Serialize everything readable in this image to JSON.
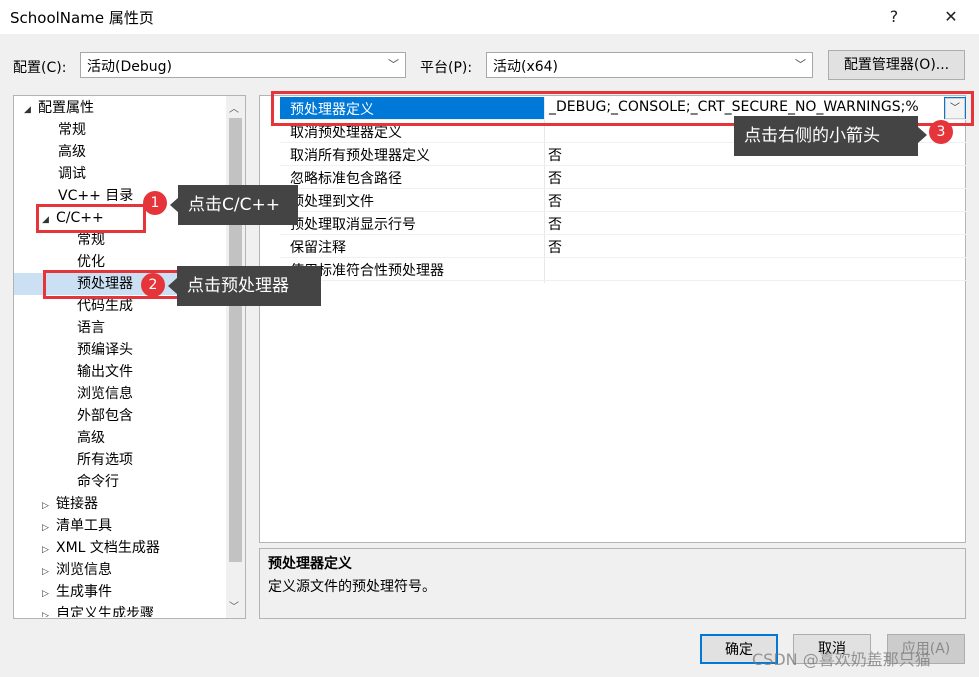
{
  "window": {
    "title": "SchoolName 属性页",
    "help_label": "?",
    "close_label": "✕"
  },
  "config_bar": {
    "config_label": "配置(C):",
    "config_value": "活动(Debug)",
    "platform_label": "平台(P):",
    "platform_value": "活动(x64)",
    "manager_button": "配置管理器(O)..."
  },
  "tree": {
    "items": [
      {
        "label": "配置属性",
        "toggle": "◢"
      },
      {
        "label": "常规"
      },
      {
        "label": "高级"
      },
      {
        "label": "调试"
      },
      {
        "label": "VC++ 目录"
      },
      {
        "label": "C/C++",
        "toggle": "◢"
      },
      {
        "label": "常规"
      },
      {
        "label": "优化"
      },
      {
        "label": "预处理器"
      },
      {
        "label": "代码生成"
      },
      {
        "label": "语言"
      },
      {
        "label": "预编译头"
      },
      {
        "label": "输出文件"
      },
      {
        "label": "浏览信息"
      },
      {
        "label": "外部包含"
      },
      {
        "label": "高级"
      },
      {
        "label": "所有选项"
      },
      {
        "label": "命令行"
      },
      {
        "label": "链接器",
        "toggle": "▷"
      },
      {
        "label": "清单工具",
        "toggle": "▷"
      },
      {
        "label": "XML 文档生成器",
        "toggle": "▷"
      },
      {
        "label": "浏览信息",
        "toggle": "▷"
      },
      {
        "label": "生成事件",
        "toggle": "▷"
      },
      {
        "label": "自定义生成步骤",
        "toggle": "▷"
      }
    ]
  },
  "grid": {
    "rows": [
      {
        "name": "预处理器定义",
        "value": "_DEBUG;_CONSOLE;_CRT_SECURE_NO_WARNINGS;%"
      },
      {
        "name": "取消预处理器定义",
        "value": ""
      },
      {
        "name": "取消所有预处理器定义",
        "value": "否"
      },
      {
        "name": "忽略标准包含路径",
        "value": "否"
      },
      {
        "name": "预处理到文件",
        "value": "否"
      },
      {
        "name": "预处理取消显示行号",
        "value": "否"
      },
      {
        "name": "保留注释",
        "value": "否"
      },
      {
        "name": "使用标准符合性预处理器",
        "value": ""
      }
    ]
  },
  "description": {
    "title": "预处理器定义",
    "text": "定义源文件的预处理符号。"
  },
  "buttons": {
    "ok": "确定",
    "cancel": "取消",
    "apply": "应用(A)"
  },
  "annotations": {
    "step1": {
      "number": "1",
      "text": "点击C/C++"
    },
    "step2": {
      "number": "2",
      "text": "点击预处理器"
    },
    "step3": {
      "number": "3",
      "text": "点击右侧的小箭头"
    },
    "color": "#e5353b"
  },
  "watermark": "CSDN @喜欢奶盖那只猫"
}
